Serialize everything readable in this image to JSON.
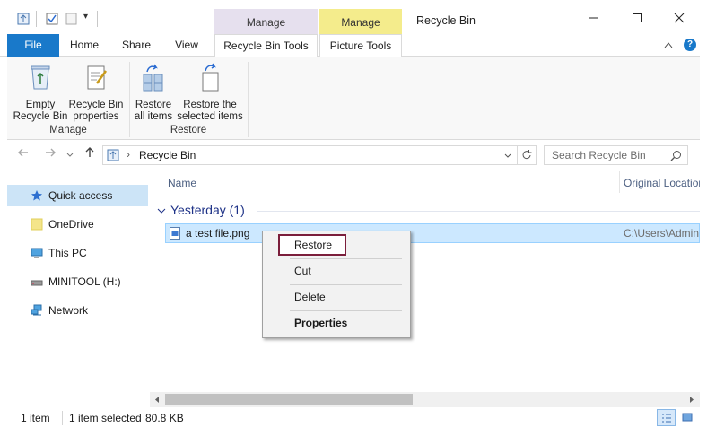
{
  "window": {
    "title": "Recycle Bin",
    "minimize": "—",
    "maximize": "☐",
    "close": "✕"
  },
  "context_tabs": {
    "manage_rbt": "Manage",
    "manage_pt": "Manage",
    "manage_rbt_color": "#e6e0ee",
    "manage_pt_color": "#f4ec8c"
  },
  "tabs": {
    "file": "File",
    "home": "Home",
    "share": "Share",
    "view": "View",
    "recycle_bin_tools": "Recycle Bin Tools",
    "picture_tools": "Picture Tools",
    "collapse": "^",
    "help": "?"
  },
  "ribbon": {
    "empty": "Empty\nRecycle Bin",
    "empty_line1": "Empty",
    "empty_line2": "Recycle Bin",
    "props_line1": "Recycle Bin",
    "props_line2": "properties",
    "restore_all_line1": "Restore",
    "restore_all_line2": "all items",
    "restore_sel_line1": "Restore the",
    "restore_sel_line2": "selected items",
    "group_manage": "Manage",
    "group_restore": "Restore"
  },
  "address": {
    "path": "Recycle Bin",
    "search_placeholder": "Search Recycle Bin"
  },
  "nav": {
    "quick_access": "Quick access",
    "onedrive": "OneDrive",
    "this_pc": "This PC",
    "minitool": "MINITOOL (H:)",
    "network": "Network"
  },
  "files": {
    "col_name": "Name",
    "col_original": "Original Location",
    "group": "Yesterday (1)",
    "file_name": "a test file.png",
    "file_path": "C:\\Users\\Admin"
  },
  "context_menu": {
    "restore": "Restore",
    "cut": "Cut",
    "delete": "Delete",
    "properties": "Properties"
  },
  "status": {
    "items": "1 item",
    "selected": "1 item selected",
    "size": "80.8 KB"
  },
  "colors": {
    "accent": "#1979ca",
    "highlight_border": "#7b1e3b",
    "selection": "#cce8ff"
  }
}
